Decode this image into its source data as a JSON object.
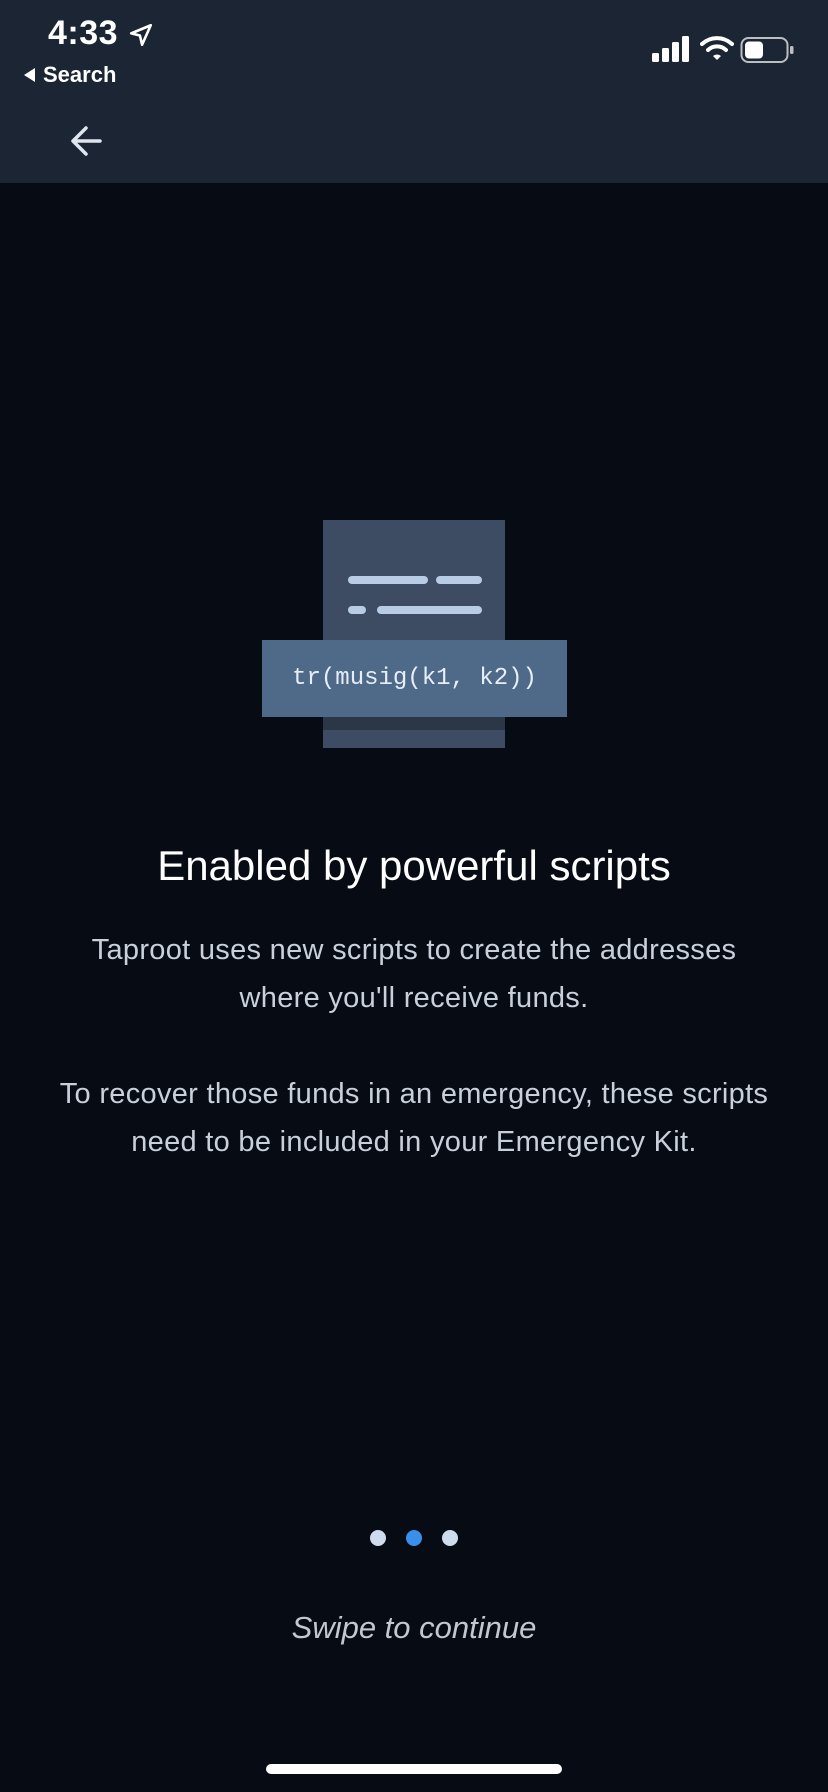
{
  "status_bar": {
    "time": "4:33",
    "back_app_label": "Search"
  },
  "illustration": {
    "code": "tr(musig(k1, k2))"
  },
  "content": {
    "title": "Enabled by powerful scripts",
    "paragraph_1": "Taproot uses new scripts to create the addresses where you'll receive funds.",
    "paragraph_2": "To recover those funds in an emergency, these scripts need to be included in your Emergency Kit."
  },
  "pager": {
    "count": 3,
    "active_index": 1
  },
  "footer": {
    "hint": "Swipe to continue"
  },
  "colors": {
    "background": "#060b14",
    "header": "#1c2533",
    "accent": "#3a8fe8"
  }
}
